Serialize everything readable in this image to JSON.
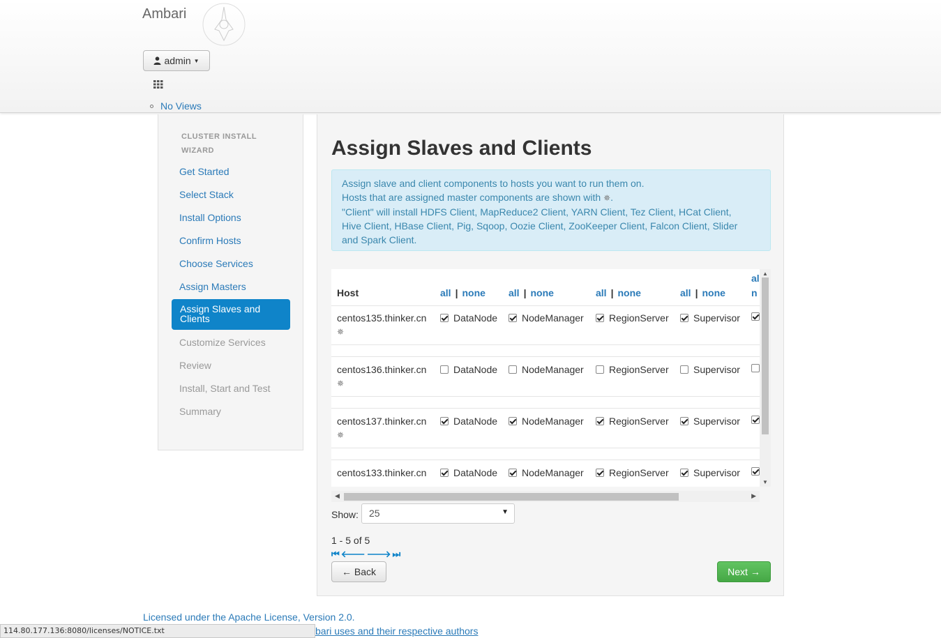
{
  "header": {
    "brand": "Ambari",
    "user_button": "admin",
    "views_link": "No Views"
  },
  "sidebar": {
    "title": "CLUSTER INSTALL WIZARD",
    "steps": [
      {
        "label": "Get Started",
        "state": "link"
      },
      {
        "label": "Select Stack",
        "state": "link"
      },
      {
        "label": "Install Options",
        "state": "link"
      },
      {
        "label": "Confirm Hosts",
        "state": "link"
      },
      {
        "label": "Choose Services",
        "state": "link"
      },
      {
        "label": "Assign Masters",
        "state": "link"
      },
      {
        "label": "Assign Slaves and Clients",
        "state": "active"
      },
      {
        "label": "Customize Services",
        "state": "disabled"
      },
      {
        "label": "Review",
        "state": "disabled"
      },
      {
        "label": "Install, Start and Test",
        "state": "disabled"
      },
      {
        "label": "Summary",
        "state": "disabled"
      }
    ]
  },
  "main": {
    "title": "Assign Slaves and Clients",
    "info_lines": [
      "Assign slave and client components to hosts you want to run them on.",
      "Hosts that are assigned master components are shown with",
      "\"Client\" will install HDFS Client, MapReduce2 Client, YARN Client, Tez Client, HCat Client,",
      "Hive Client, HBase Client, Pig, Sqoop, Oozie Client, ZooKeeper Client, Falcon Client, Slider",
      "and Spark Client."
    ],
    "info_line2_suffix": "."
  },
  "table": {
    "host_header": "Host",
    "all_label": "all",
    "none_label": "none",
    "sep": "|",
    "partial_all": "al",
    "partial_none": "n",
    "master_marker": "✵",
    "rows": [
      {
        "host": "centos135.thinker.cn",
        "master": true,
        "checks": [
          true,
          true,
          true,
          true,
          true
        ]
      },
      {
        "host": "centos136.thinker.cn",
        "master": true,
        "checks": [
          false,
          false,
          false,
          false,
          false
        ]
      },
      {
        "host": "centos137.thinker.cn",
        "master": true,
        "checks": [
          true,
          true,
          true,
          true,
          true
        ]
      },
      {
        "host": "centos133.thinker.cn",
        "master": false,
        "checks": [
          true,
          true,
          true,
          true,
          true
        ]
      }
    ],
    "components": [
      "DataNode",
      "NodeManager",
      "RegionServer",
      "Supervisor"
    ]
  },
  "pagination": {
    "show_label": "Show:",
    "show_value": "25",
    "range": "1 - 5 of 5"
  },
  "buttons": {
    "back": "← Back",
    "next": "Next →"
  },
  "footer": {
    "license": "Licensed under the Apache License, Version 2.0.",
    "notice": "bari uses and their respective authors",
    "status_url": "114.80.177.136:8080/licenses/NOTICE.txt"
  }
}
